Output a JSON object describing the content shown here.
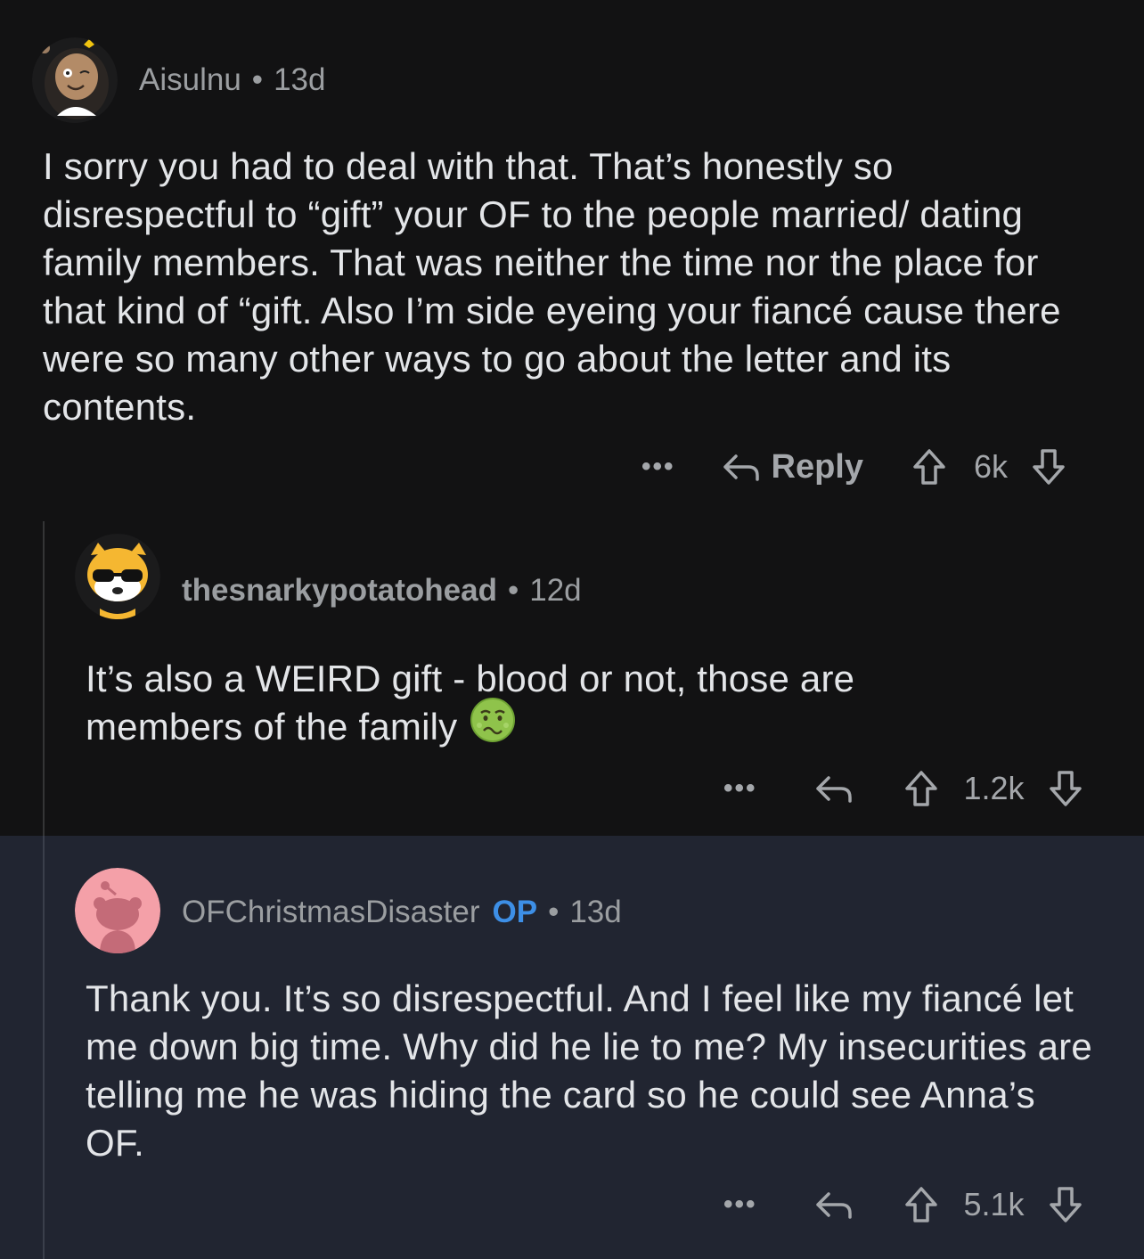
{
  "comments": [
    {
      "author": "Aisulnu",
      "separator": "•",
      "age": "13d",
      "body": "I sorry you had to deal with that. That’s honestly so disrespectful to “gift” your OF to the people married/ dating family members. That was neither the time nor the place for that kind of “gift. Also I’m side eyeing your fiancé cause there were so many other ways to go about the letter and its contents.",
      "more": "•••",
      "reply_label": "Reply",
      "score": "6k",
      "avatar_icon": "woman-avatar-icon"
    },
    {
      "author": "thesnarkypotatohead",
      "separator": "•",
      "age": "12d",
      "body": "It’s also a WEIRD gift - blood or not, those are members of the family",
      "emoji": "nauseated-face-emoji",
      "more": "•••",
      "score": "1.2k",
      "avatar_icon": "dog-with-sunglasses-avatar-icon"
    },
    {
      "author": "OFChristmasDisaster",
      "op_badge": "OP",
      "separator": "•",
      "age": "13d",
      "body": "Thank you. It’s so disrespectful. And I feel like my fiancé let me down big time. Why did he lie to me? My insecurities are telling me he was hiding the card so he could see Anna’s OF.",
      "more": "•••",
      "score": "5.1k",
      "avatar_icon": "default-snoo-avatar-icon"
    }
  ],
  "colors": {
    "background": "#121213",
    "highlight_background": "#212531",
    "op_badge": "#3d8fe6",
    "meta_text": "#9b9ea1",
    "body_text": "#e3e5e8"
  }
}
